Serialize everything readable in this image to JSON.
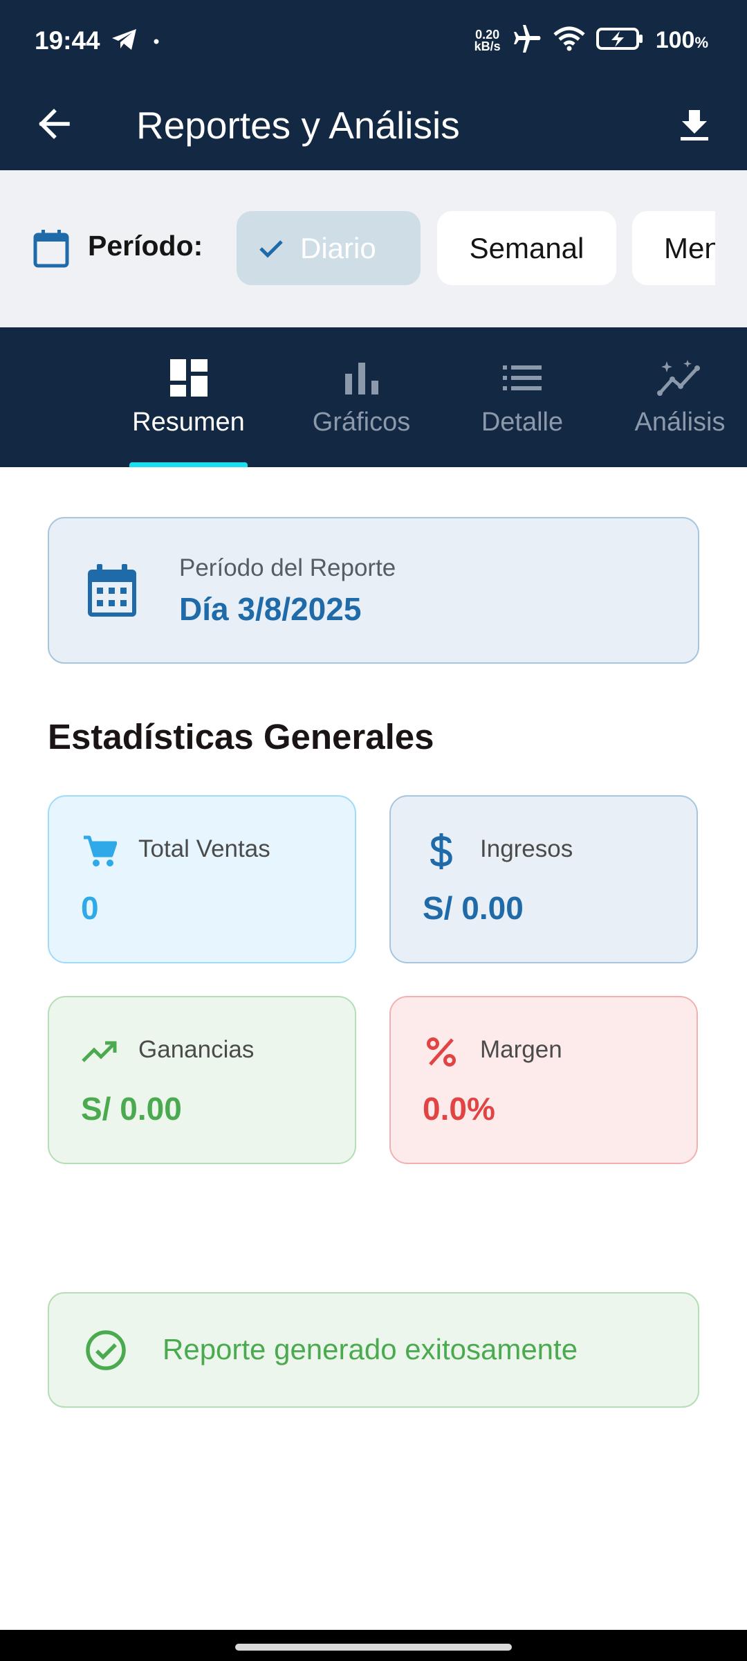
{
  "status_bar": {
    "time": "19:44",
    "net_speed_value": "0.20",
    "net_speed_unit": "kB/s",
    "battery_percent": "100",
    "battery_suffix": "%",
    "icons": [
      "telegram-icon",
      "dot-icon",
      "airplane-icon",
      "wifi-icon",
      "battery-charging-icon"
    ]
  },
  "app_bar": {
    "title": "Reportes y Análisis",
    "back_icon": "arrow-back-icon",
    "download_icon": "download-icon"
  },
  "period_filter": {
    "label": "Período:",
    "options": [
      {
        "label": "Diario",
        "selected": true
      },
      {
        "label": "Semanal",
        "selected": false
      },
      {
        "label": "Mensual",
        "selected": false
      }
    ]
  },
  "tabs": [
    {
      "label": "Resumen",
      "icon": "dashboard-icon",
      "active": true
    },
    {
      "label": "Gráficos",
      "icon": "bar-chart-icon",
      "active": false
    },
    {
      "label": "Detalle",
      "icon": "list-icon",
      "active": false
    },
    {
      "label": "Análisis",
      "icon": "insights-icon",
      "active": false
    }
  ],
  "report_period": {
    "subtitle": "Período del Reporte",
    "date": "Día 3/8/2025"
  },
  "stats": {
    "title": "Estadísticas Generales",
    "total_ventas": {
      "label": "Total Ventas",
      "value": "0",
      "icon": "cart-icon"
    },
    "ingresos": {
      "label": "Ingresos",
      "value": "S/ 0.00",
      "icon": "dollar-icon"
    },
    "ganancias": {
      "label": "Ganancias",
      "value": "S/ 0.00",
      "icon": "trending-up-icon"
    },
    "margen": {
      "label": "Margen",
      "value": "0.0%",
      "icon": "percent-icon"
    }
  },
  "banner": {
    "text": "Reporte generado exitosamente",
    "icon": "check-circle-icon"
  },
  "colors": {
    "primary_dark": "#132842",
    "accent": "#19e0f1",
    "blue": "#1f6aa8",
    "light_blue": "#2fa9e8",
    "green": "#4baa4f",
    "red": "#e04444"
  }
}
